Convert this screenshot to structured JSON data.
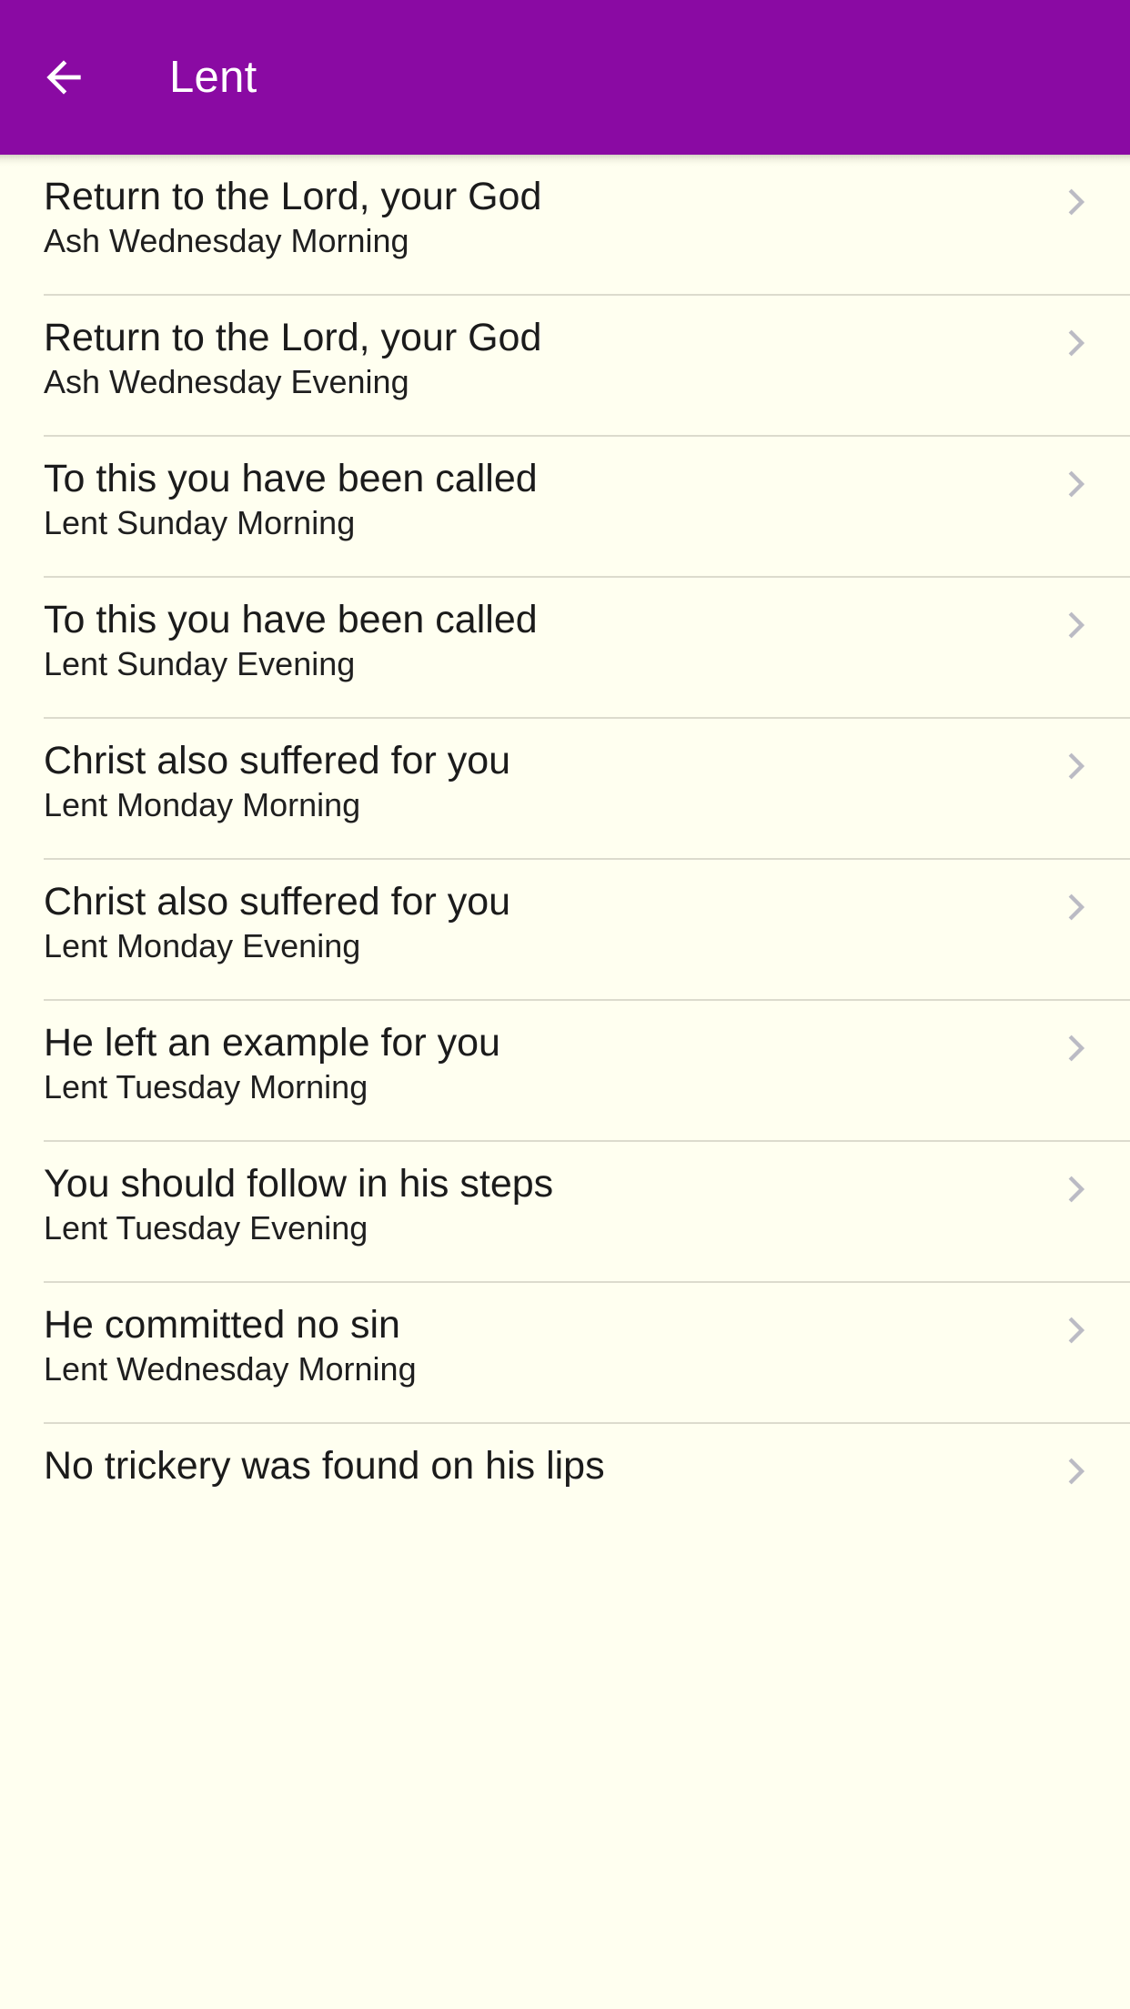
{
  "app": {
    "background_color": "#FFFFF0",
    "accent_color": "#8A0AA3"
  },
  "header": {
    "title": "Lent",
    "back_icon": "arrow-back-icon",
    "background_color": "#8A0AA3",
    "text_color": "#FFFFFF"
  },
  "list": {
    "chevron_icon": "chevron-right-icon",
    "chevron_color": "#BBBBC4",
    "divider_color": "#DCDBCD",
    "items": [
      {
        "title": "Return to the Lord, your God",
        "subtitle": "Ash Wednesday Morning"
      },
      {
        "title": "Return to the Lord, your God",
        "subtitle": "Ash Wednesday Evening"
      },
      {
        "title": "To this you have been called",
        "subtitle": "Lent Sunday Morning"
      },
      {
        "title": "To this you have been called",
        "subtitle": "Lent Sunday Evening"
      },
      {
        "title": "Christ also suffered for you",
        "subtitle": "Lent Monday Morning"
      },
      {
        "title": "Christ also suffered for you",
        "subtitle": "Lent Monday Evening"
      },
      {
        "title": "He left an example for you",
        "subtitle": "Lent Tuesday Morning"
      },
      {
        "title": "You should follow in his steps",
        "subtitle": "Lent Tuesday Evening"
      },
      {
        "title": "He committed no sin",
        "subtitle": "Lent Wednesday Morning"
      },
      {
        "title": "No trickery was found on his lips",
        "subtitle": ""
      }
    ]
  }
}
